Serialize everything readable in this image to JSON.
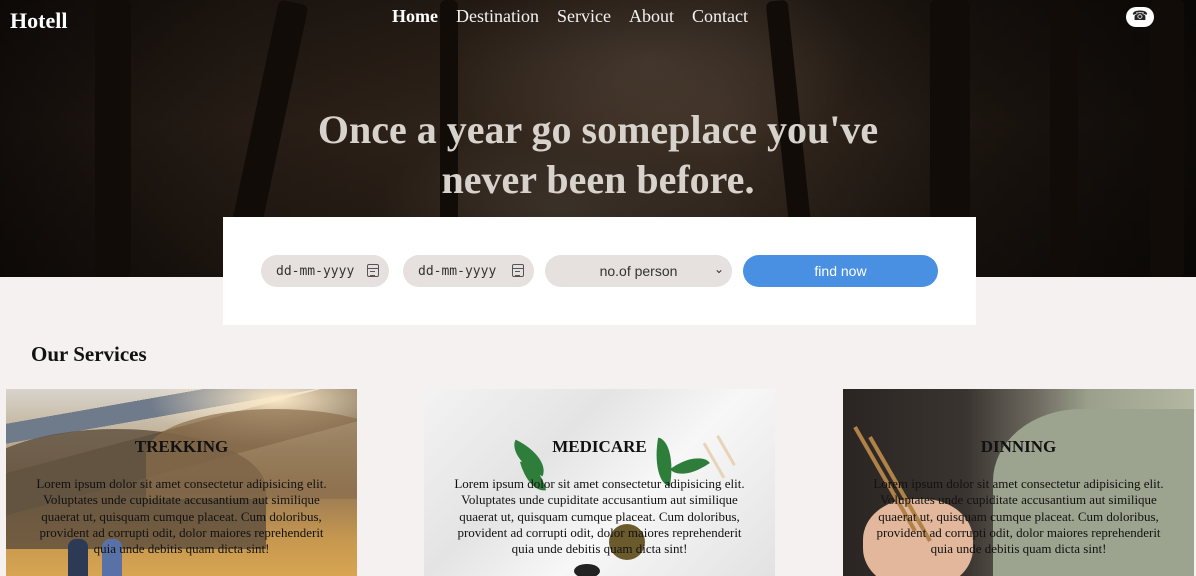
{
  "header": {
    "logo": "Hotell",
    "nav": [
      "Home",
      "Destination",
      "Service",
      "About",
      "Contact"
    ],
    "phone_icon": "☎"
  },
  "hero": {
    "headline_line1": "Once a year go someplace you've",
    "headline_line2": "never been before."
  },
  "booking": {
    "checkin_value": "dd-mm-yyyy",
    "checkout_value": "dd-mm-yyyy",
    "persons_selected": "no.of person",
    "find_label": "find now"
  },
  "services": {
    "title": "Our Services",
    "cards": [
      {
        "title": "TREKKING",
        "desc": "Lorem ipsum dolor sit amet consectetur adipisicing elit. Voluptates unde cupiditate accusantium aut similique quaerat ut, quisquam cumque placeat. Cum doloribus, provident ad corrupti odit, dolor maiores reprehenderit quia unde debitis quam dicta sint!"
      },
      {
        "title": "MEDICARE",
        "desc": "Lorem ipsum dolor sit amet consectetur adipisicing elit. Voluptates unde cupiditate accusantium aut similique quaerat ut, quisquam cumque placeat. Cum doloribus, provident ad corrupti odit, dolor maiores reprehenderit quia unde debitis quam dicta sint!"
      },
      {
        "title": "DINNING",
        "desc": "Lorem ipsum dolor sit amet consectetur adipisicing elit. Voluptates unde cupiditate accusantium aut similique quaerat ut, quisquam cumque placeat. Cum doloribus, provident ad corrupti odit, dolor maiores reprehenderit quia unde debitis quam dicta sint!"
      }
    ]
  }
}
